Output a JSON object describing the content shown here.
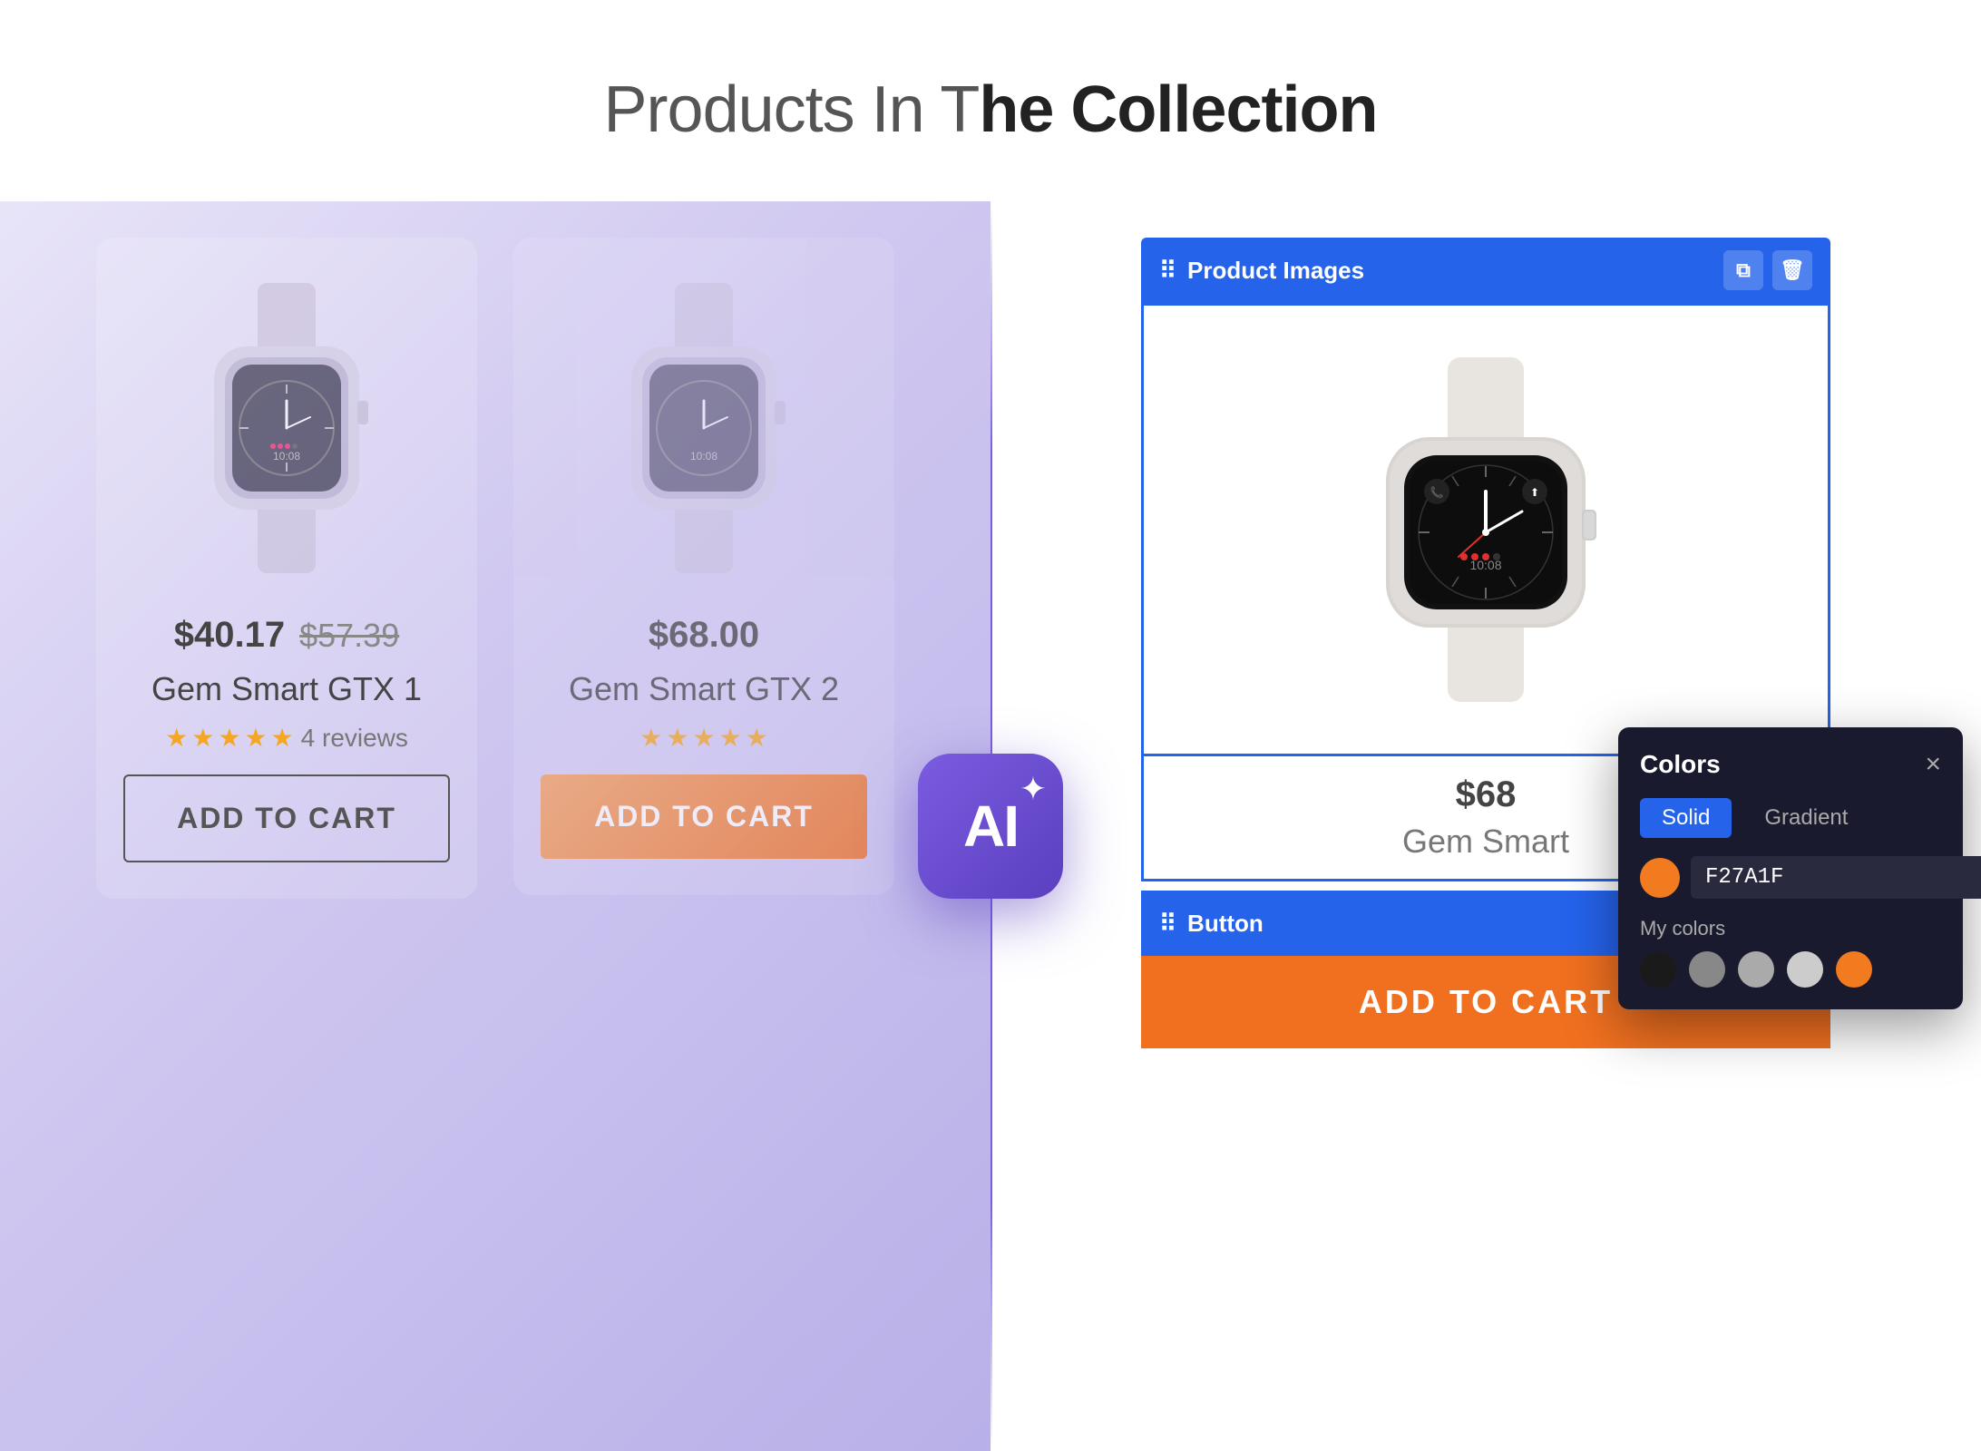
{
  "page": {
    "title_before": "Products In T",
    "title_bold": "he Collection",
    "title_display": "Products In The Collection"
  },
  "products": [
    {
      "id": "product-1",
      "price_current": "$40.17",
      "price_original": "$57.39",
      "name": "Gem Smart GTX 1",
      "stars": [
        1,
        1,
        1,
        1,
        0.5
      ],
      "reviews": "4 reviews",
      "button_label": "ADD TO CART",
      "button_style": "outline"
    },
    {
      "id": "product-2",
      "price_current": "$68.00",
      "price_original": null,
      "name": "Gem Smart GTX 2",
      "stars": [
        1,
        1,
        1,
        1,
        1
      ],
      "reviews": null,
      "button_label": "ADD TO CART",
      "button_style": "orange"
    }
  ],
  "right_panel": {
    "widget_images_label": "Product Images",
    "product_price": "$68",
    "product_name": "Gem Smart",
    "button_widget_label": "Button",
    "add_to_cart_label": "ADD TO CART"
  },
  "colors_popup": {
    "title": "Colors",
    "tab_solid": "Solid",
    "tab_gradient": "Gradient",
    "hex_value": "F27A1F",
    "my_colors_label": "My colors",
    "swatches": [
      {
        "color": "#1a1a1a"
      },
      {
        "color": "#888888"
      },
      {
        "color": "#aaaaaa"
      },
      {
        "color": "#cccccc"
      },
      {
        "color": "#f27a1f"
      }
    ]
  },
  "ai_badge": {
    "text": "AI",
    "sparkle": "✦"
  },
  "icons": {
    "drag": "⠿",
    "copy": "⧉",
    "trash": "🗑",
    "close": "×",
    "edit_pen": "✏"
  }
}
